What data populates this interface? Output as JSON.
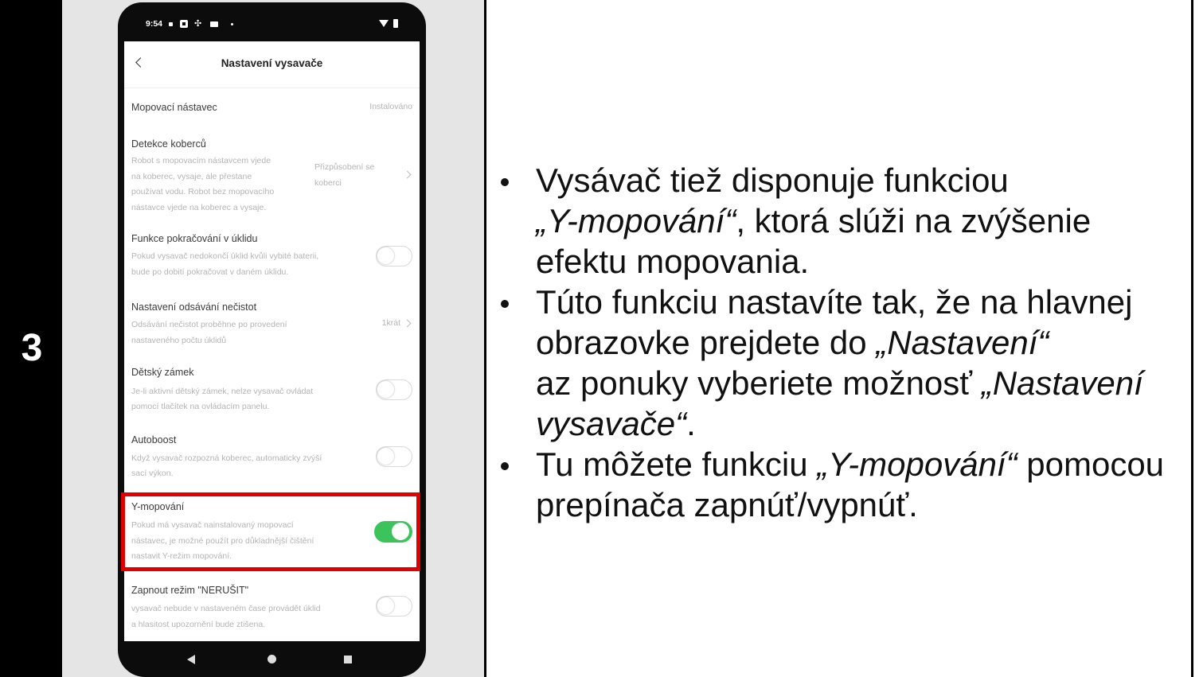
{
  "step": {
    "number": "3"
  },
  "phone": {
    "status_bar": {
      "time": "9:54",
      "icons_left": [
        "notification-dot-icon",
        "app-badge-icon",
        "fan-icon",
        "message-icon",
        "more-notifications-icon"
      ],
      "icons_right": [
        "wifi-icon",
        "battery-icon"
      ]
    },
    "header": {
      "back_icon": "chevron-left-icon",
      "title": "Nastavení vysavače"
    },
    "settings": [
      {
        "title": "Mopovací nástavec",
        "value": "Instalováno"
      },
      {
        "title": "Detekce koberců",
        "description": [
          "Robot s mopovacím nástavcem vjede",
          "na koberec, vysaje, ale přestane",
          "používat vodu. Robot bez mopovacího",
          "nástavce vjede na koberec a vysaje."
        ],
        "value": [
          "Přizpůsobení se",
          "koberci"
        ],
        "chevron_icon": "chevron-right-icon"
      },
      {
        "title": "Funkce pokračování v úklidu",
        "description": [
          "Pokud vysavač nedokončí úklid kvůli vybité baterii,",
          "bude po dobití pokračovat v daném úklidu."
        ],
        "enabled": false
      },
      {
        "title": "Nastavení odsávání nečistot",
        "description": [
          "Odsávání nečistot proběhne po provedení",
          "nastaveného počtu úklidů"
        ],
        "value": "1krát",
        "chevron_icon": "chevron-right-icon"
      },
      {
        "title": "Dětský zámek",
        "description": [
          "Je-li aktivní dětský zámek, nelze vysavač ovládat",
          "pomocí tlačítek na ovládacím panelu."
        ],
        "enabled": false
      },
      {
        "title": "Autoboost",
        "description": [
          "Když vysavač rozpozná koberec, automaticky zvýší",
          "sací výkon."
        ],
        "enabled": false
      },
      {
        "title": "Y-mopování",
        "description": [
          "Pokud má vysavač nainstalovaný mopovací",
          "nástavec, je možné použít pro důkladnější čištění",
          "nastavit Y-režim mopování."
        ],
        "enabled": true,
        "highlighted": true
      },
      {
        "title": "Zapnout režim \"NERUŠIT\"",
        "description": [
          "vysavač nebude v nastaveném čase provádět úklid",
          "a hlasitost upozornění bude ztišena."
        ],
        "enabled": false
      }
    ],
    "nav_bar": {
      "icons": [
        "back-icon",
        "home-icon",
        "recent-apps-icon"
      ]
    }
  },
  "instructions": {
    "bullets": [
      {
        "lines": [
          [
            {
              "text": "Vysávač tiež disponuje funkciou"
            }
          ],
          [
            {
              "text": "„Y-mopování“",
              "italic": true
            },
            {
              "text": ", ktorá slúži na zvýšenie"
            }
          ],
          [
            {
              "text": "efektu mopovania."
            }
          ]
        ]
      },
      {
        "lines": [
          [
            {
              "text": "Túto funkciu nastavíte tak, že na hlavnej"
            }
          ],
          [
            {
              "text": "obrazovke prejdete do "
            },
            {
              "text": "„Nastavení“",
              "italic": true
            }
          ],
          [
            {
              "text": "az ponuky vyberiete možnosť "
            },
            {
              "text": "„Nastavení",
              "italic": true
            }
          ],
          [
            {
              "text": "vysavače“",
              "italic": true
            },
            {
              "text": "."
            }
          ]
        ]
      },
      {
        "lines": [
          [
            {
              "text": "Tu môžete funkciu "
            },
            {
              "text": "„Y-mopování“",
              "italic": true
            },
            {
              "text": " pomocou"
            }
          ],
          [
            {
              "text": "prepínača zapnúť/vypnúť."
            }
          ]
        ]
      }
    ]
  },
  "colors": {
    "step_column": "#000000",
    "side_panel": "#e5e5e5",
    "highlight_border": "#e10000",
    "toggle_on": "#3dc35b",
    "text": "#111111"
  }
}
